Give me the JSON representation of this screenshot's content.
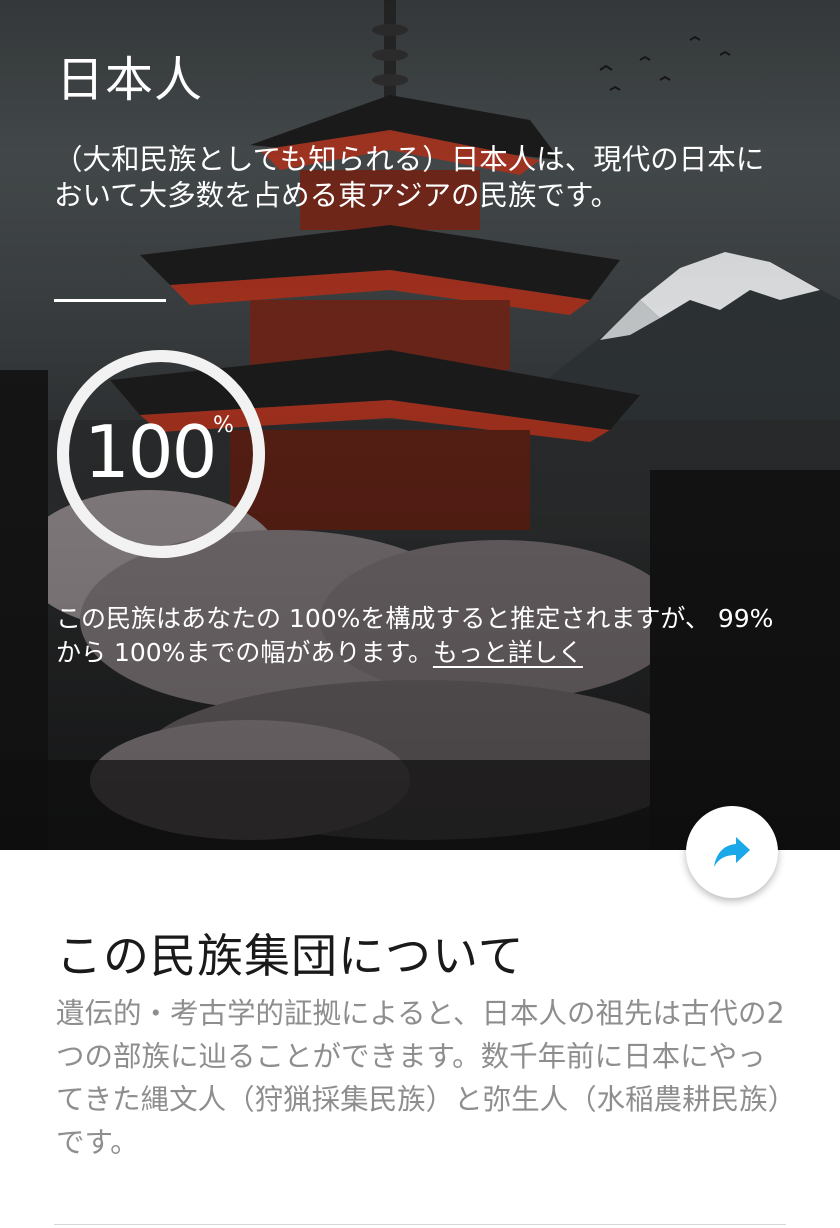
{
  "hero": {
    "title": "日本人",
    "description": "（大和民族としても知られる）日本人は、現代の日本において大多数を占める東アジアの民族です。",
    "percentage": {
      "value": "100",
      "sign": "%",
      "fill": 1.0
    },
    "estimate_text": "この民族はあなたの 100%を構成すると推定されますが、 99% から 100%までの幅があります。",
    "learn_more_link": "もっと詳しく"
  },
  "share_button": {
    "icon": "share-arrow-icon",
    "color": "#1aa8e8"
  },
  "about": {
    "heading": "この民族集団について",
    "body": "遺伝的・考古学的証拠によると、日本人の祖先は古代の2つの部族に辿ることができます。数千年前に日本にやってきた縄文人（狩猟採集民族）と弥生人（水稲農耕民族）です。"
  }
}
